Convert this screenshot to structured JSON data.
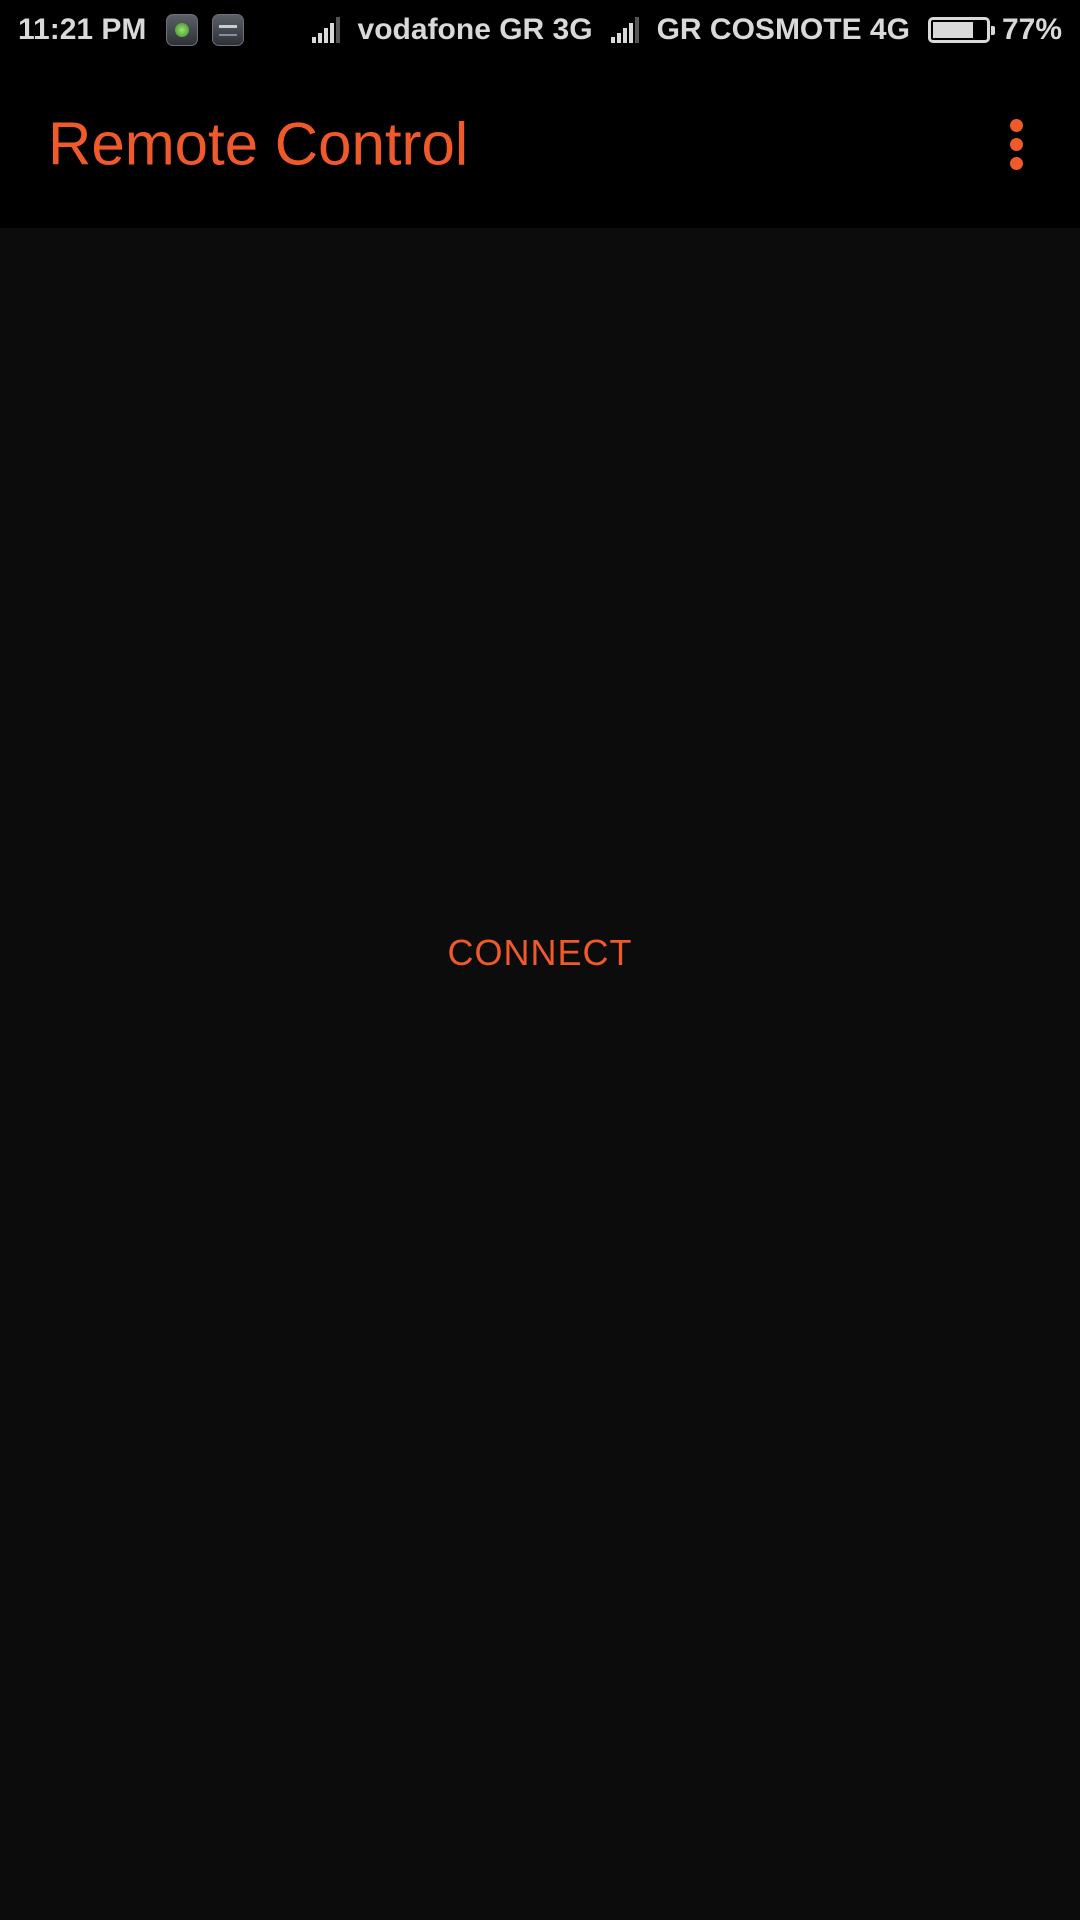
{
  "status_bar": {
    "time": "11:21 PM",
    "notification_icons": [
      "app-notification-icon",
      "keyboard-notification-icon"
    ],
    "carrier_1": "vodafone GR 3G",
    "carrier_2": "GR COSMOTE 4G",
    "battery_percent_text": "77%",
    "battery_level": 0.77
  },
  "app_bar": {
    "title": "Remote Control",
    "menu_icon": "more-vert-icon"
  },
  "main": {
    "connect_label": "CONNECT"
  },
  "colors": {
    "accent": "#f05a2a",
    "app_bar_background": "#000000",
    "content_background": "#0c0c0c",
    "status_text": "#d9d9d9"
  }
}
